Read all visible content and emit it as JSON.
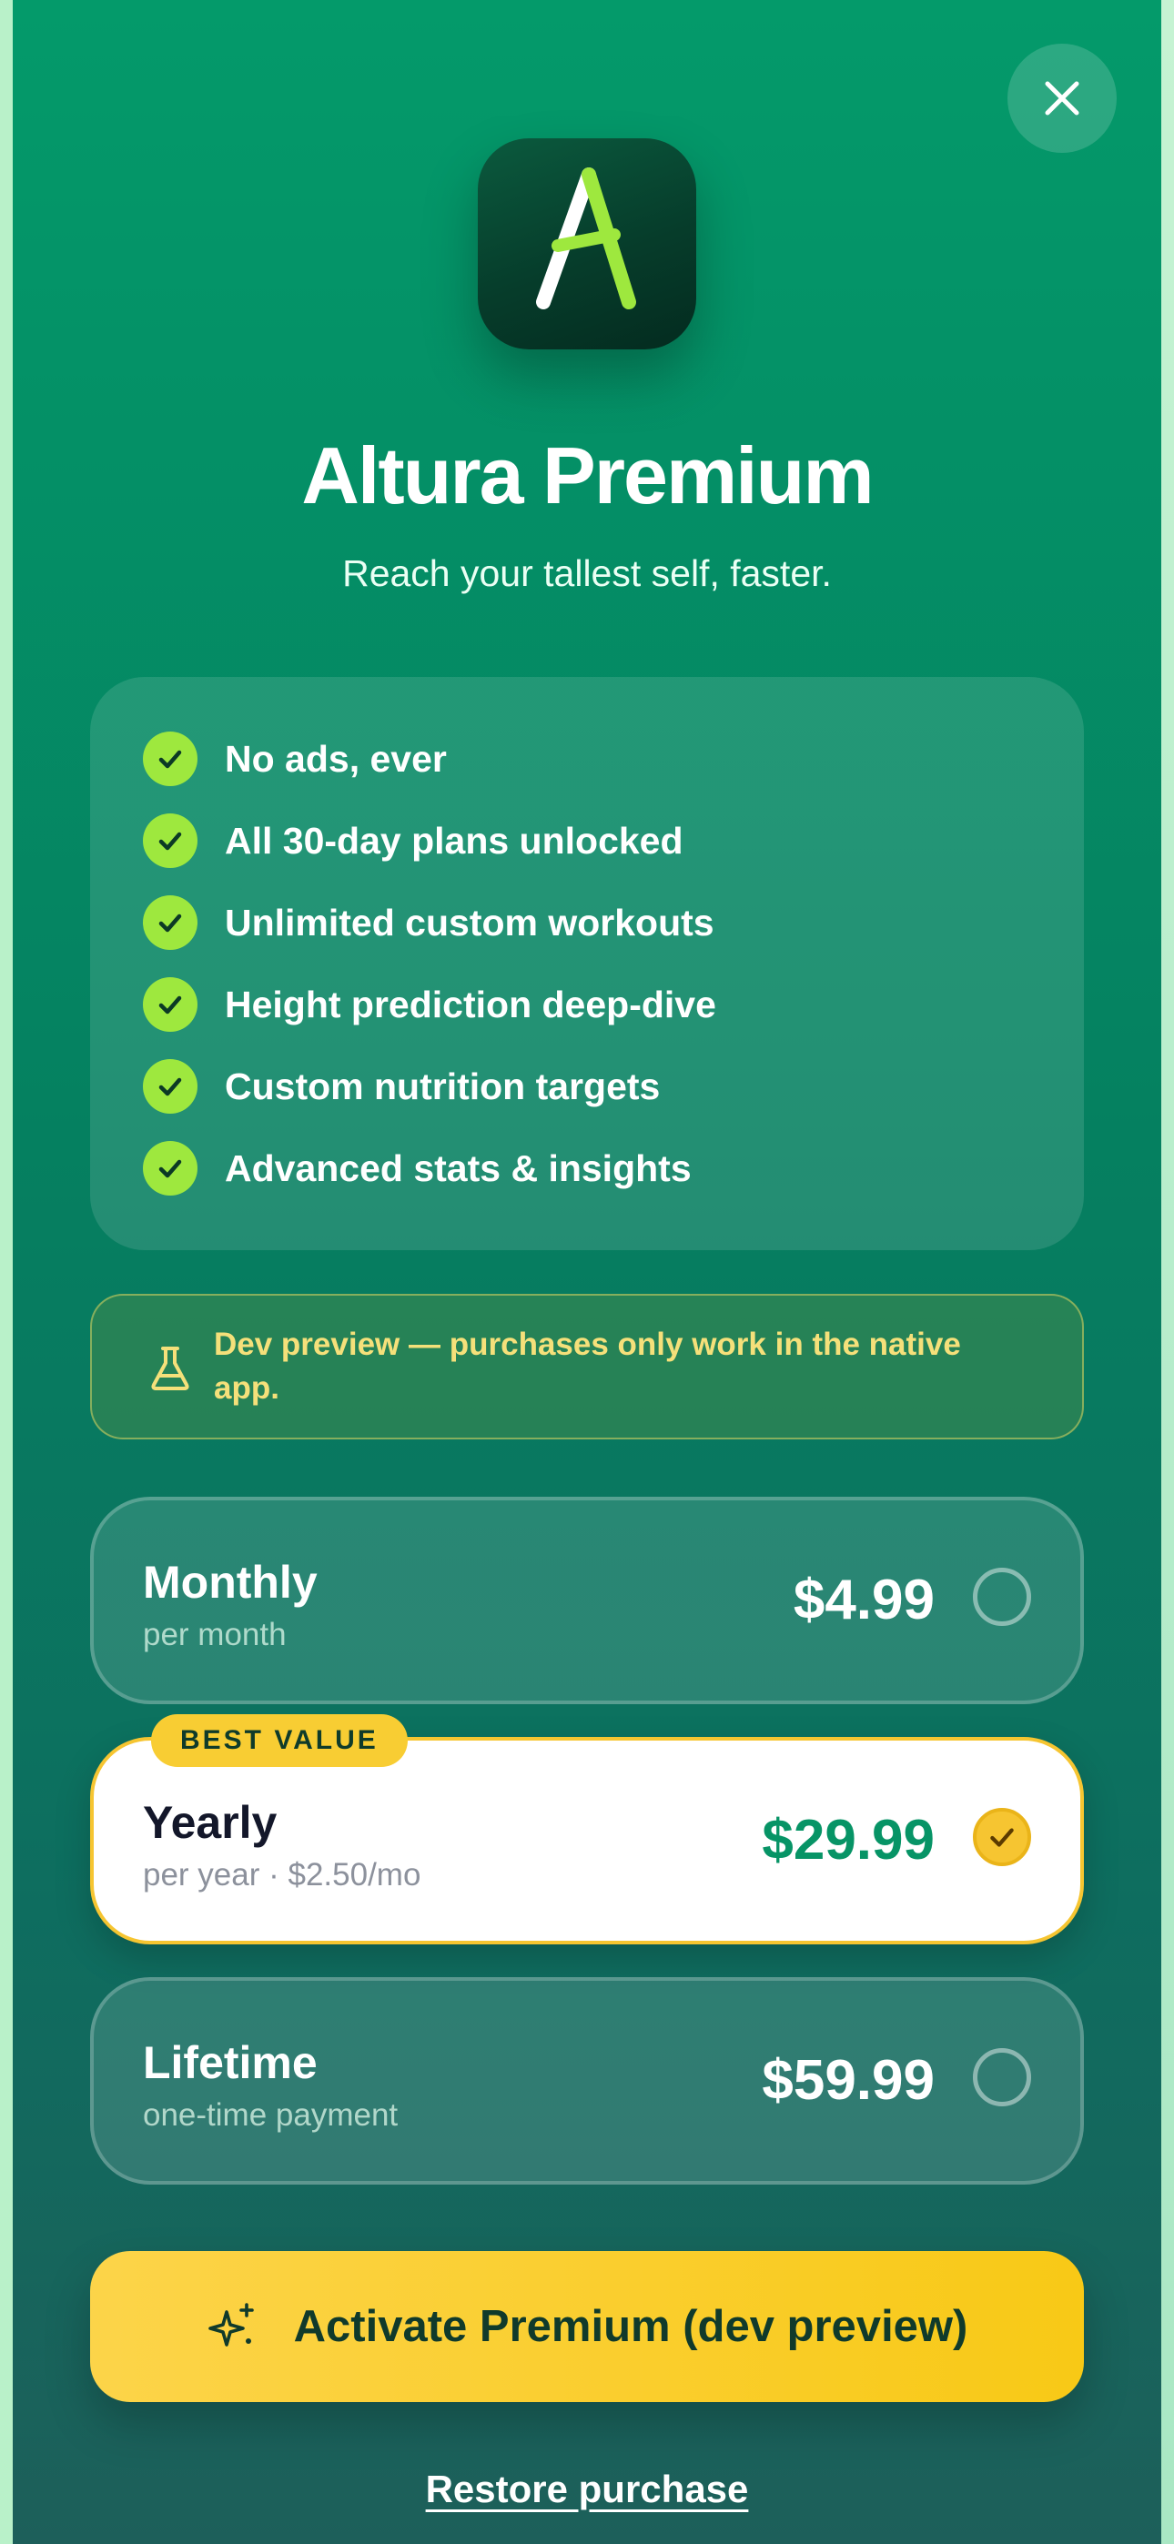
{
  "header": {
    "title": "Altura Premium",
    "subtitle": "Reach your tallest self, faster.",
    "close_icon": "close-icon",
    "app_icon": "altura-app-icon"
  },
  "features": [
    {
      "label": "No ads, ever",
      "icon": "check-icon"
    },
    {
      "label": "All 30-day plans unlocked",
      "icon": "check-icon"
    },
    {
      "label": "Unlimited custom workouts",
      "icon": "check-icon"
    },
    {
      "label": "Height prediction deep-dive",
      "icon": "check-icon"
    },
    {
      "label": "Custom nutrition targets",
      "icon": "check-icon"
    },
    {
      "label": "Advanced stats & insights",
      "icon": "check-icon"
    }
  ],
  "dev_banner": {
    "icon": "flask-icon",
    "text": "Dev preview — purchases only work in the native app."
  },
  "plans": [
    {
      "name": "Monthly",
      "sub": "per month",
      "price": "$4.99",
      "selected": false
    },
    {
      "name": "Yearly",
      "sub": "per year · $2.50/mo",
      "price": "$29.99",
      "selected": true,
      "badge": "BEST VALUE"
    },
    {
      "name": "Lifetime",
      "sub": "one-time payment",
      "price": "$59.99",
      "selected": false
    }
  ],
  "cta": {
    "label": "Activate Premium (dev preview)",
    "icon": "sparkles-icon"
  },
  "restore_label": "Restore purchase",
  "colors": {
    "background_top": "#049a6a",
    "background_bottom": "#1d5f5a",
    "accent_yellow": "#f8cd33",
    "check_green": "#9ee83e",
    "price_green": "#079466"
  }
}
